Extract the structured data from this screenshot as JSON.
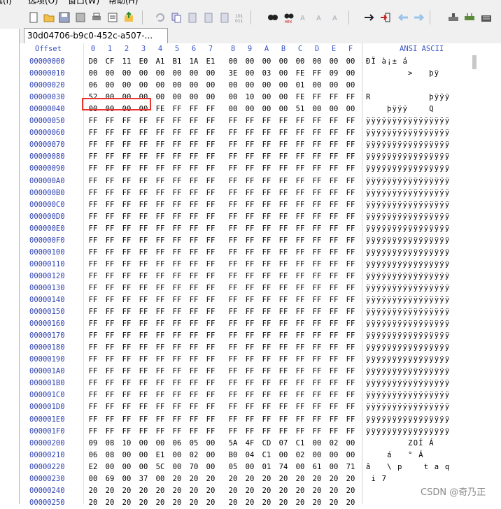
{
  "menu": {
    "items": [
      "具(I)",
      "选项(O)",
      "窗口(W)",
      "帮助(H)"
    ]
  },
  "toolbar": {
    "icons": [
      "new-file-icon",
      "open-folder-icon",
      "save-icon",
      "save-all-icon",
      "print-icon",
      "properties-icon",
      "export-icon",
      "undo-icon",
      "copy-icon",
      "paste-icon",
      "paste-special-icon",
      "clipboard-icon",
      "binary-icon",
      "find-icon",
      "find-hex-icon",
      "find-next-icon",
      "find-text-icon",
      "replace-icon",
      "goto-icon",
      "insert-icon",
      "back-arrow-icon",
      "forward-arrow-icon",
      "disk-icon",
      "ram-icon",
      "calculator-icon"
    ]
  },
  "tab": {
    "label": "30d04706-b9c0-452c-a507-..."
  },
  "hex": {
    "offset_label": "Offset",
    "ascii_label": "ANSI ASCII",
    "columns": [
      "0",
      "1",
      "2",
      "3",
      "4",
      "5",
      "6",
      "7",
      "8",
      "9",
      "A",
      "B",
      "C",
      "D",
      "E",
      "F"
    ],
    "rows": [
      {
        "offset": "00000000",
        "bytes": [
          "D0",
          "CF",
          "11",
          "E0",
          "A1",
          "B1",
          "1A",
          "E1",
          "00",
          "00",
          "00",
          "00",
          "00",
          "00",
          "00",
          "00"
        ],
        "ascii": "ÐÏ à¡± á"
      },
      {
        "offset": "00000010",
        "bytes": [
          "00",
          "00",
          "00",
          "00",
          "00",
          "00",
          "00",
          "00",
          "3E",
          "00",
          "03",
          "00",
          "FE",
          "FF",
          "09",
          "00"
        ],
        "ascii": "        >   þÿ"
      },
      {
        "offset": "00000020",
        "bytes": [
          "06",
          "00",
          "00",
          "00",
          "00",
          "00",
          "00",
          "00",
          "00",
          "00",
          "00",
          "00",
          "01",
          "00",
          "00",
          "00"
        ],
        "ascii": ""
      },
      {
        "offset": "00000030",
        "bytes": [
          "52",
          "00",
          "00",
          "00",
          "00",
          "00",
          "00",
          "00",
          "00",
          "10",
          "00",
          "00",
          "FE",
          "FF",
          "FF",
          "FF"
        ],
        "ascii": "R           þÿÿÿ"
      },
      {
        "offset": "00000040",
        "bytes": [
          "00",
          "00",
          "00",
          "00",
          "FE",
          "FF",
          "FF",
          "FF",
          "00",
          "00",
          "00",
          "00",
          "51",
          "00",
          "00",
          "00"
        ],
        "ascii": "    þÿÿÿ    Q"
      },
      {
        "offset": "00000050",
        "bytes": [
          "FF",
          "FF",
          "FF",
          "FF",
          "FF",
          "FF",
          "FF",
          "FF",
          "FF",
          "FF",
          "FF",
          "FF",
          "FF",
          "FF",
          "FF",
          "FF"
        ],
        "ascii": "ÿÿÿÿÿÿÿÿÿÿÿÿÿÿÿÿ"
      },
      {
        "offset": "00000060",
        "bytes": [
          "FF",
          "FF",
          "FF",
          "FF",
          "FF",
          "FF",
          "FF",
          "FF",
          "FF",
          "FF",
          "FF",
          "FF",
          "FF",
          "FF",
          "FF",
          "FF"
        ],
        "ascii": "ÿÿÿÿÿÿÿÿÿÿÿÿÿÿÿÿ"
      },
      {
        "offset": "00000070",
        "bytes": [
          "FF",
          "FF",
          "FF",
          "FF",
          "FF",
          "FF",
          "FF",
          "FF",
          "FF",
          "FF",
          "FF",
          "FF",
          "FF",
          "FF",
          "FF",
          "FF"
        ],
        "ascii": "ÿÿÿÿÿÿÿÿÿÿÿÿÿÿÿÿ"
      },
      {
        "offset": "00000080",
        "bytes": [
          "FF",
          "FF",
          "FF",
          "FF",
          "FF",
          "FF",
          "FF",
          "FF",
          "FF",
          "FF",
          "FF",
          "FF",
          "FF",
          "FF",
          "FF",
          "FF"
        ],
        "ascii": "ÿÿÿÿÿÿÿÿÿÿÿÿÿÿÿÿ"
      },
      {
        "offset": "00000090",
        "bytes": [
          "FF",
          "FF",
          "FF",
          "FF",
          "FF",
          "FF",
          "FF",
          "FF",
          "FF",
          "FF",
          "FF",
          "FF",
          "FF",
          "FF",
          "FF",
          "FF"
        ],
        "ascii": "ÿÿÿÿÿÿÿÿÿÿÿÿÿÿÿÿ"
      },
      {
        "offset": "000000A0",
        "bytes": [
          "FF",
          "FF",
          "FF",
          "FF",
          "FF",
          "FF",
          "FF",
          "FF",
          "FF",
          "FF",
          "FF",
          "FF",
          "FF",
          "FF",
          "FF",
          "FF"
        ],
        "ascii": "ÿÿÿÿÿÿÿÿÿÿÿÿÿÿÿÿ"
      },
      {
        "offset": "000000B0",
        "bytes": [
          "FF",
          "FF",
          "FF",
          "FF",
          "FF",
          "FF",
          "FF",
          "FF",
          "FF",
          "FF",
          "FF",
          "FF",
          "FF",
          "FF",
          "FF",
          "FF"
        ],
        "ascii": "ÿÿÿÿÿÿÿÿÿÿÿÿÿÿÿÿ"
      },
      {
        "offset": "000000C0",
        "bytes": [
          "FF",
          "FF",
          "FF",
          "FF",
          "FF",
          "FF",
          "FF",
          "FF",
          "FF",
          "FF",
          "FF",
          "FF",
          "FF",
          "FF",
          "FF",
          "FF"
        ],
        "ascii": "ÿÿÿÿÿÿÿÿÿÿÿÿÿÿÿÿ"
      },
      {
        "offset": "000000D0",
        "bytes": [
          "FF",
          "FF",
          "FF",
          "FF",
          "FF",
          "FF",
          "FF",
          "FF",
          "FF",
          "FF",
          "FF",
          "FF",
          "FF",
          "FF",
          "FF",
          "FF"
        ],
        "ascii": "ÿÿÿÿÿÿÿÿÿÿÿÿÿÿÿÿ"
      },
      {
        "offset": "000000E0",
        "bytes": [
          "FF",
          "FF",
          "FF",
          "FF",
          "FF",
          "FF",
          "FF",
          "FF",
          "FF",
          "FF",
          "FF",
          "FF",
          "FF",
          "FF",
          "FF",
          "FF"
        ],
        "ascii": "ÿÿÿÿÿÿÿÿÿÿÿÿÿÿÿÿ"
      },
      {
        "offset": "000000F0",
        "bytes": [
          "FF",
          "FF",
          "FF",
          "FF",
          "FF",
          "FF",
          "FF",
          "FF",
          "FF",
          "FF",
          "FF",
          "FF",
          "FF",
          "FF",
          "FF",
          "FF"
        ],
        "ascii": "ÿÿÿÿÿÿÿÿÿÿÿÿÿÿÿÿ"
      },
      {
        "offset": "00000100",
        "bytes": [
          "FF",
          "FF",
          "FF",
          "FF",
          "FF",
          "FF",
          "FF",
          "FF",
          "FF",
          "FF",
          "FF",
          "FF",
          "FF",
          "FF",
          "FF",
          "FF"
        ],
        "ascii": "ÿÿÿÿÿÿÿÿÿÿÿÿÿÿÿÿ"
      },
      {
        "offset": "00000110",
        "bytes": [
          "FF",
          "FF",
          "FF",
          "FF",
          "FF",
          "FF",
          "FF",
          "FF",
          "FF",
          "FF",
          "FF",
          "FF",
          "FF",
          "FF",
          "FF",
          "FF"
        ],
        "ascii": "ÿÿÿÿÿÿÿÿÿÿÿÿÿÿÿÿ"
      },
      {
        "offset": "00000120",
        "bytes": [
          "FF",
          "FF",
          "FF",
          "FF",
          "FF",
          "FF",
          "FF",
          "FF",
          "FF",
          "FF",
          "FF",
          "FF",
          "FF",
          "FF",
          "FF",
          "FF"
        ],
        "ascii": "ÿÿÿÿÿÿÿÿÿÿÿÿÿÿÿÿ"
      },
      {
        "offset": "00000130",
        "bytes": [
          "FF",
          "FF",
          "FF",
          "FF",
          "FF",
          "FF",
          "FF",
          "FF",
          "FF",
          "FF",
          "FF",
          "FF",
          "FF",
          "FF",
          "FF",
          "FF"
        ],
        "ascii": "ÿÿÿÿÿÿÿÿÿÿÿÿÿÿÿÿ"
      },
      {
        "offset": "00000140",
        "bytes": [
          "FF",
          "FF",
          "FF",
          "FF",
          "FF",
          "FF",
          "FF",
          "FF",
          "FF",
          "FF",
          "FF",
          "FF",
          "FF",
          "FF",
          "FF",
          "FF"
        ],
        "ascii": "ÿÿÿÿÿÿÿÿÿÿÿÿÿÿÿÿ"
      },
      {
        "offset": "00000150",
        "bytes": [
          "FF",
          "FF",
          "FF",
          "FF",
          "FF",
          "FF",
          "FF",
          "FF",
          "FF",
          "FF",
          "FF",
          "FF",
          "FF",
          "FF",
          "FF",
          "FF"
        ],
        "ascii": "ÿÿÿÿÿÿÿÿÿÿÿÿÿÿÿÿ"
      },
      {
        "offset": "00000160",
        "bytes": [
          "FF",
          "FF",
          "FF",
          "FF",
          "FF",
          "FF",
          "FF",
          "FF",
          "FF",
          "FF",
          "FF",
          "FF",
          "FF",
          "FF",
          "FF",
          "FF"
        ],
        "ascii": "ÿÿÿÿÿÿÿÿÿÿÿÿÿÿÿÿ"
      },
      {
        "offset": "00000170",
        "bytes": [
          "FF",
          "FF",
          "FF",
          "FF",
          "FF",
          "FF",
          "FF",
          "FF",
          "FF",
          "FF",
          "FF",
          "FF",
          "FF",
          "FF",
          "FF",
          "FF"
        ],
        "ascii": "ÿÿÿÿÿÿÿÿÿÿÿÿÿÿÿÿ"
      },
      {
        "offset": "00000180",
        "bytes": [
          "FF",
          "FF",
          "FF",
          "FF",
          "FF",
          "FF",
          "FF",
          "FF",
          "FF",
          "FF",
          "FF",
          "FF",
          "FF",
          "FF",
          "FF",
          "FF"
        ],
        "ascii": "ÿÿÿÿÿÿÿÿÿÿÿÿÿÿÿÿ"
      },
      {
        "offset": "00000190",
        "bytes": [
          "FF",
          "FF",
          "FF",
          "FF",
          "FF",
          "FF",
          "FF",
          "FF",
          "FF",
          "FF",
          "FF",
          "FF",
          "FF",
          "FF",
          "FF",
          "FF"
        ],
        "ascii": "ÿÿÿÿÿÿÿÿÿÿÿÿÿÿÿÿ"
      },
      {
        "offset": "000001A0",
        "bytes": [
          "FF",
          "FF",
          "FF",
          "FF",
          "FF",
          "FF",
          "FF",
          "FF",
          "FF",
          "FF",
          "FF",
          "FF",
          "FF",
          "FF",
          "FF",
          "FF"
        ],
        "ascii": "ÿÿÿÿÿÿÿÿÿÿÿÿÿÿÿÿ"
      },
      {
        "offset": "000001B0",
        "bytes": [
          "FF",
          "FF",
          "FF",
          "FF",
          "FF",
          "FF",
          "FF",
          "FF",
          "FF",
          "FF",
          "FF",
          "FF",
          "FF",
          "FF",
          "FF",
          "FF"
        ],
        "ascii": "ÿÿÿÿÿÿÿÿÿÿÿÿÿÿÿÿ"
      },
      {
        "offset": "000001C0",
        "bytes": [
          "FF",
          "FF",
          "FF",
          "FF",
          "FF",
          "FF",
          "FF",
          "FF",
          "FF",
          "FF",
          "FF",
          "FF",
          "FF",
          "FF",
          "FF",
          "FF"
        ],
        "ascii": "ÿÿÿÿÿÿÿÿÿÿÿÿÿÿÿÿ"
      },
      {
        "offset": "000001D0",
        "bytes": [
          "FF",
          "FF",
          "FF",
          "FF",
          "FF",
          "FF",
          "FF",
          "FF",
          "FF",
          "FF",
          "FF",
          "FF",
          "FF",
          "FF",
          "FF",
          "FF"
        ],
        "ascii": "ÿÿÿÿÿÿÿÿÿÿÿÿÿÿÿÿ"
      },
      {
        "offset": "000001E0",
        "bytes": [
          "FF",
          "FF",
          "FF",
          "FF",
          "FF",
          "FF",
          "FF",
          "FF",
          "FF",
          "FF",
          "FF",
          "FF",
          "FF",
          "FF",
          "FF",
          "FF"
        ],
        "ascii": "ÿÿÿÿÿÿÿÿÿÿÿÿÿÿÿÿ"
      },
      {
        "offset": "000001F0",
        "bytes": [
          "FF",
          "FF",
          "FF",
          "FF",
          "FF",
          "FF",
          "FF",
          "FF",
          "FF",
          "FF",
          "FF",
          "FF",
          "FF",
          "FF",
          "FF",
          "FF"
        ],
        "ascii": "ÿÿÿÿÿÿÿÿÿÿÿÿÿÿÿÿ"
      },
      {
        "offset": "00000200",
        "bytes": [
          "09",
          "08",
          "10",
          "00",
          "00",
          "06",
          "05",
          "00",
          "5A",
          "4F",
          "CD",
          "07",
          "C1",
          "00",
          "02",
          "00"
        ],
        "ascii": "        ZOÍ Á"
      },
      {
        "offset": "00000210",
        "bytes": [
          "06",
          "08",
          "00",
          "00",
          "E1",
          "00",
          "02",
          "00",
          "B0",
          "04",
          "C1",
          "00",
          "02",
          "00",
          "00",
          "00"
        ],
        "ascii": "    á   ° Á"
      },
      {
        "offset": "00000220",
        "bytes": [
          "E2",
          "00",
          "00",
          "00",
          "5C",
          "00",
          "70",
          "00",
          "05",
          "00",
          "01",
          "74",
          "00",
          "61",
          "00",
          "71"
        ],
        "ascii": "â   \\ p    t a q"
      },
      {
        "offset": "00000230",
        "bytes": [
          "00",
          "69",
          "00",
          "37",
          "00",
          "20",
          "20",
          "20",
          "20",
          "20",
          "20",
          "20",
          "20",
          "20",
          "20",
          "20"
        ],
        "ascii": " i 7"
      },
      {
        "offset": "00000240",
        "bytes": [
          "20",
          "20",
          "20",
          "20",
          "20",
          "20",
          "20",
          "20",
          "20",
          "20",
          "20",
          "20",
          "20",
          "20",
          "20",
          "20"
        ],
        "ascii": ""
      },
      {
        "offset": "00000250",
        "bytes": [
          "20",
          "20",
          "20",
          "20",
          "20",
          "20",
          "20",
          "20",
          "20",
          "20",
          "20",
          "20",
          "20",
          "20",
          "20",
          "20"
        ],
        "ascii": ""
      }
    ]
  },
  "watermark": "CSDN @奇乃正",
  "colors": {
    "offset_text": "#2a3fb0",
    "header_text": "#3a55c4",
    "highlight": "#e8352e"
  }
}
